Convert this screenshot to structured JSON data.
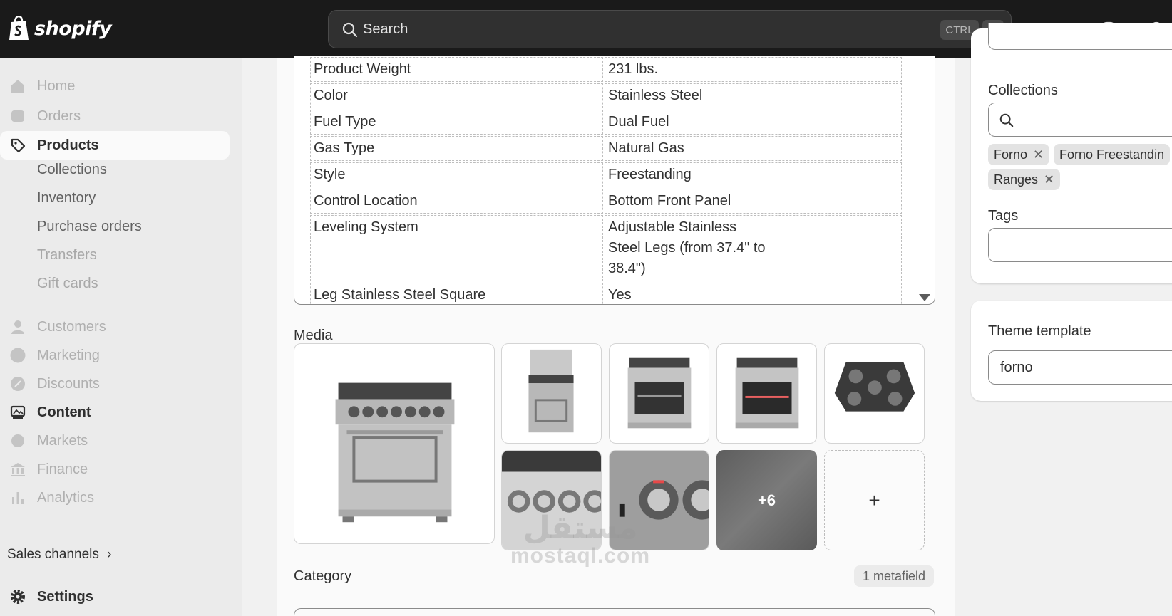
{
  "app": {
    "logo_text": "shopify"
  },
  "search": {
    "placeholder": "Search",
    "shortcut_ctrl": "CTRL",
    "shortcut_key": "K"
  },
  "sidebar": {
    "items": [
      {
        "label": "Home",
        "icon": "home-icon"
      },
      {
        "label": "Orders",
        "icon": "inbox-icon"
      },
      {
        "label": "Products",
        "icon": "tag-icon"
      },
      {
        "label": "Customers",
        "icon": "person-icon"
      },
      {
        "label": "Marketing",
        "icon": "target-icon"
      },
      {
        "label": "Discounts",
        "icon": "discount-icon"
      },
      {
        "label": "Content",
        "icon": "image-icon"
      },
      {
        "label": "Markets",
        "icon": "globe-icon"
      },
      {
        "label": "Finance",
        "icon": "bank-icon"
      },
      {
        "label": "Analytics",
        "icon": "bar-chart-icon"
      }
    ],
    "product_sub": [
      "Collections",
      "Inventory",
      "Purchase orders",
      "Transfers",
      "Gift cards"
    ],
    "sales_channels": "Sales channels",
    "settings": "Settings"
  },
  "specs": [
    {
      "key": "Product Weight",
      "value": "231 lbs."
    },
    {
      "key": "Color",
      "value": "Stainless Steel"
    },
    {
      "key": "Fuel Type",
      "value": "Dual Fuel"
    },
    {
      "key": "Gas Type",
      "value": "Natural Gas"
    },
    {
      "key": "Style",
      "value": "Freestanding"
    },
    {
      "key": "Control Location",
      "value": "Bottom Front Panel"
    },
    {
      "key": "Leveling System",
      "value": "Adjustable Stainless\nSteel Legs (from 37.4\" to\n38.4\")"
    },
    {
      "key": "Leg Stainless Steel Square",
      "value": "Yes"
    }
  ],
  "media": {
    "label": "Media",
    "more_count": "+6",
    "add_label": "+"
  },
  "category": {
    "label": "Category",
    "metafield_badge": "1 metafield"
  },
  "watermark": {
    "arabic": "مستقل",
    "latin": "mostaql.com"
  },
  "organization": {
    "collections_label": "Collections",
    "collections": [
      "Forno",
      "Forno Freestandin",
      "Ranges"
    ],
    "tags_label": "Tags"
  },
  "theme": {
    "label": "Theme template",
    "value": "forno"
  }
}
